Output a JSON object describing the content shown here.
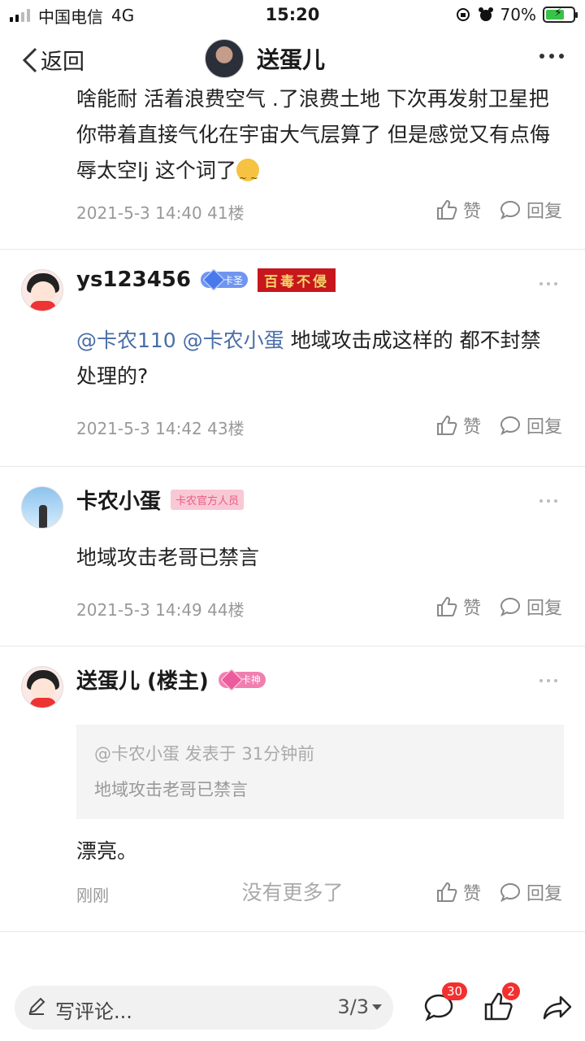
{
  "status_bar": {
    "carrier": "中国电信",
    "network": "4G",
    "time": "15:20",
    "battery": "70%",
    "battery_level": 0.7
  },
  "nav": {
    "back_label": "返回",
    "title": "送蛋儿"
  },
  "prev_post": {
    "text": "啥能耐   活着浪费空气  .了浪费土地  下次再发射卫星把你带着直接气化在宇宙大气层算了 但是感觉又有点侮辱太空lj 这个词了",
    "meta": "2021-5-3 14:40  41楼"
  },
  "actions": {
    "like": "赞",
    "reply": "回复"
  },
  "posts": [
    {
      "author": "ys123456",
      "badge": "卡圣",
      "title_badge": "百毒不侵",
      "mention1": "@卡农110",
      "mention2": "@卡农小蛋",
      "text": " 地域攻击成这样的 都不封禁处理的?",
      "meta": "2021-5-3 14:42  43楼"
    },
    {
      "author": "卡农小蛋",
      "badge": "卡农官方人员",
      "text": "地域攻击老哥已禁言",
      "meta": "2021-5-3 14:49  44楼"
    },
    {
      "author": "送蛋儿 (楼主)",
      "badge": "卡神",
      "quote_head": "@卡农小蛋 发表于 31分钟前",
      "quote_body": "地域攻击老哥已禁言",
      "text": "漂亮。",
      "meta": "刚刚"
    }
  ],
  "no_more": "没有更多了",
  "bottom": {
    "placeholder": "写评论...",
    "page": "3/3",
    "comments_count": "30",
    "likes_count": "2"
  }
}
